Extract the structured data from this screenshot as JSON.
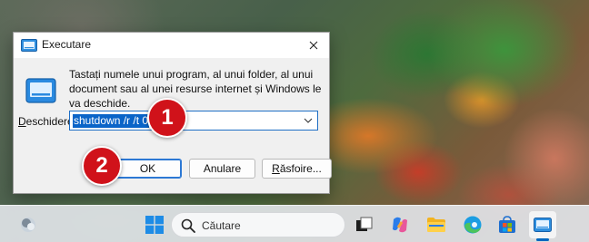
{
  "dialog": {
    "title": "Executare",
    "description": "Tastați numele unui program, al unui folder, al unui document sau al unei resurse internet și Windows le va deschide.",
    "open_label_prefix": "D",
    "open_label_rest": "eschidere:",
    "open_value": "shutdown /r /t 0",
    "ok_label": "OK",
    "cancel_label": "Anulare",
    "browse_label_prefix": "R",
    "browse_label_rest": "ăsfoire..."
  },
  "markers": {
    "step1": "1",
    "step2": "2"
  },
  "taskbar": {
    "search_placeholder": "Căutare",
    "icons": [
      "widgets-icon",
      "windows-start-icon",
      "search-icon",
      "task-view-icon",
      "copilot-icon",
      "file-explorer-icon",
      "edge-icon",
      "microsoft-store-icon",
      "run-icon"
    ]
  },
  "colors": {
    "accent": "#0067c0",
    "selection": "#0a64c8",
    "marker": "#d0121a"
  }
}
